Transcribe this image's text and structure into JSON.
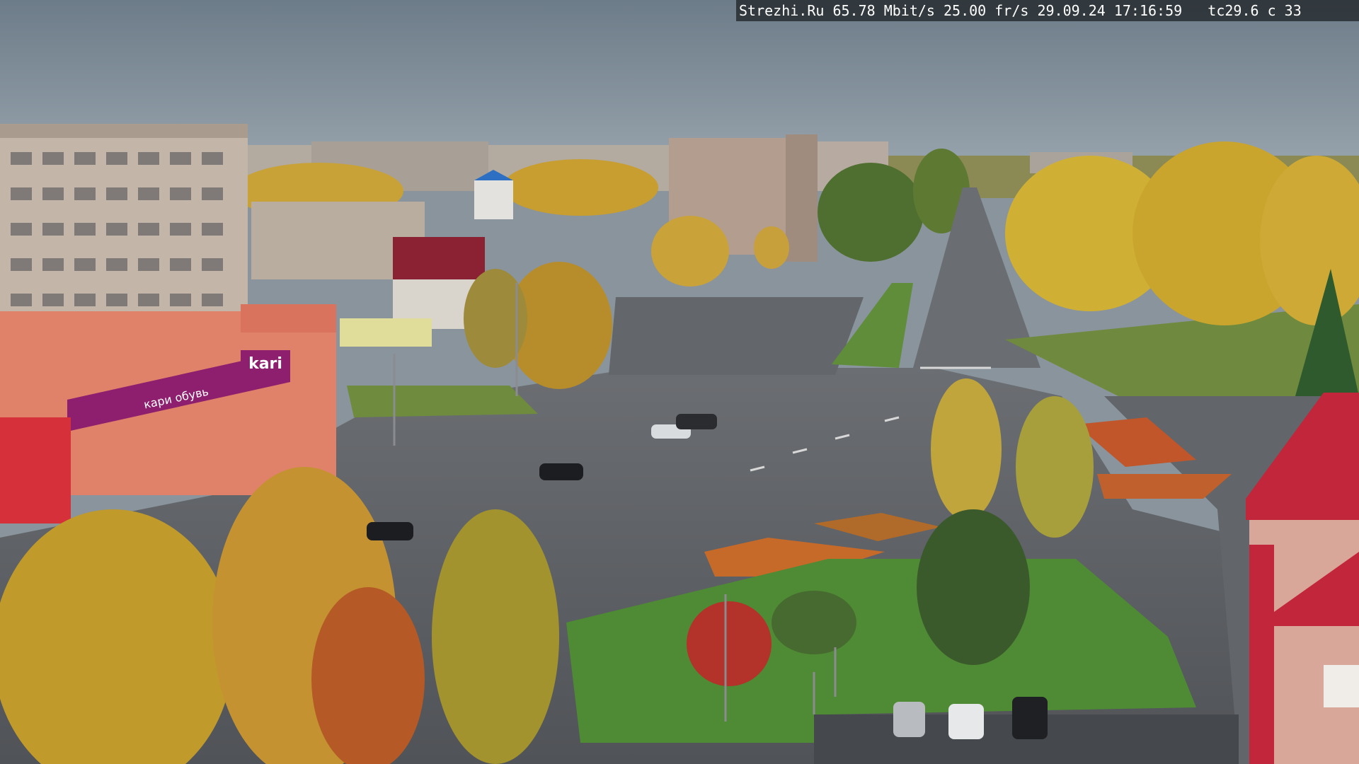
{
  "osd": {
    "site": "Strezhi.Ru",
    "bitrate": "65.78 Mbit/s",
    "framerate": "25.00 fr/s",
    "date": "29.09.24",
    "time": "17:16:59",
    "temp": "tc29.6",
    "channel": "c 33"
  },
  "signs": {
    "store_logo": "kari",
    "store_banner": "кари обувь"
  },
  "colors": {
    "sky": "#7f8f9c",
    "asphalt": "#5a5d61",
    "grass": "#5e8a3a",
    "foliage": "#c9a23a",
    "kari_purple": "#8e1f6e",
    "roof_red": "#c2263a"
  }
}
